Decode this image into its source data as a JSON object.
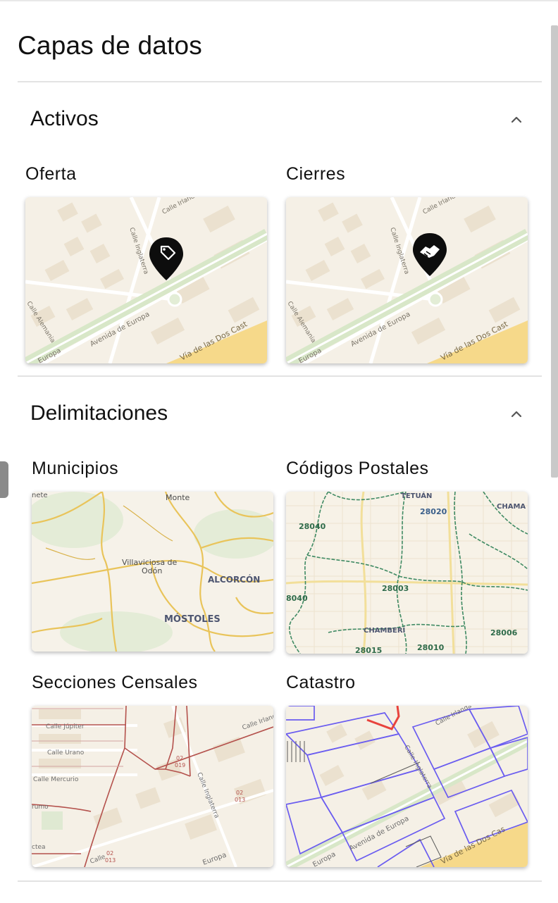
{
  "panel": {
    "title": "Capas de datos"
  },
  "sections": {
    "activos": {
      "title": "Activos",
      "items": [
        {
          "label": "Oferta",
          "icon": "price-tag-icon"
        },
        {
          "label": "Cierres",
          "icon": "handshake-icon"
        }
      ],
      "streets": [
        "Calle Irlanda",
        "Calle Inglaterra",
        "Calle Alemania",
        "Europa",
        "Avenida de Europa",
        "Vía de las Dos Cast"
      ]
    },
    "delimitaciones": {
      "title": "Delimitaciones",
      "items": [
        {
          "label": "Municipios",
          "map_labels": [
            "nete",
            "Monte",
            "Villaviciosa de",
            "Odón",
            "ALCORCÓN",
            "MÓSTOLES"
          ]
        },
        {
          "label": "Códigos Postales",
          "map_labels": [
            "TETUÁN",
            "28020",
            "CHAMA",
            "28040",
            "28003",
            "8040",
            "CHAMBERÍ",
            "28006",
            "28015",
            "28010"
          ]
        },
        {
          "label": "Secciones Censales",
          "map_labels": [
            "Calle Júpiter",
            "Calle Urano",
            "Calle Mercurio",
            "rumo",
            "ctea",
            "02",
            "019",
            "Calle Irlanda",
            "Calle Inglaterra",
            "02",
            "013",
            "Calle",
            "Europa",
            "02",
            "013"
          ]
        },
        {
          "label": "Catastro",
          "map_labels": [
            "Calle Irlanda",
            "Calle Inglaterra",
            "Europa",
            "Avenida de Europa",
            "Vía de las Dos Cas"
          ]
        }
      ]
    }
  },
  "colors": {
    "map_background": "#f5f0e6",
    "building": "#ebe1cf",
    "road_major": "#f6d98a",
    "boundary_yellow": "#e9c45a",
    "postal_green": "#3f8a63",
    "census_red": "#b4514c",
    "cadastre_purple": "#6a5cf0"
  }
}
